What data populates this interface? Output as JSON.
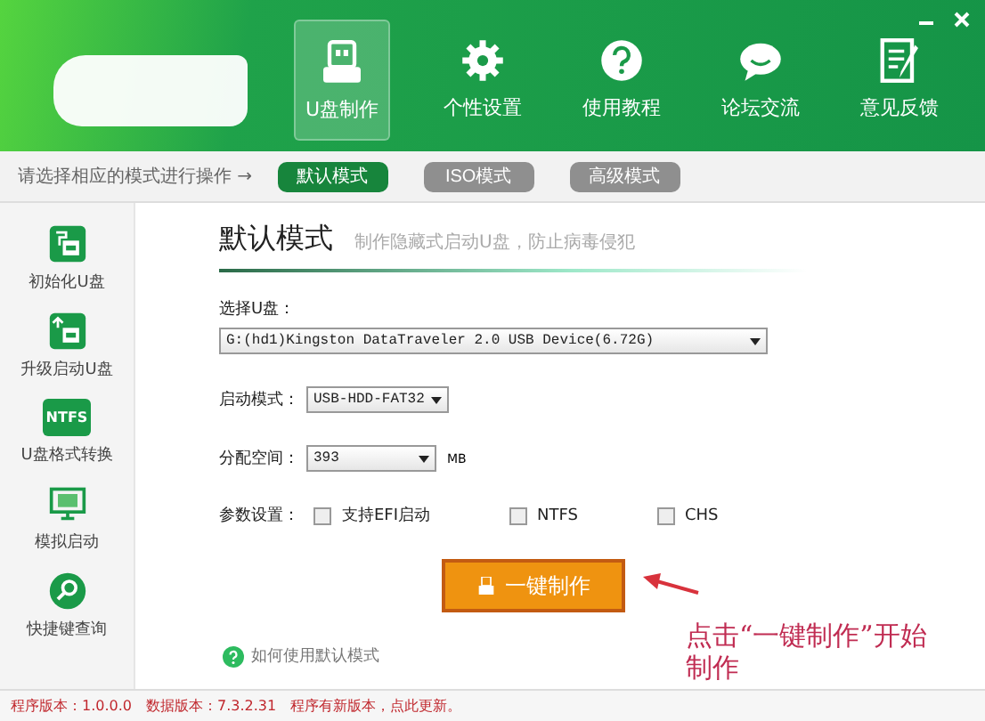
{
  "nav": [
    {
      "label": "U盘制作",
      "selected": true
    },
    {
      "label": "个性设置",
      "selected": false
    },
    {
      "label": "使用教程",
      "selected": false
    },
    {
      "label": "论坛交流",
      "selected": false
    },
    {
      "label": "意见反馈",
      "selected": false
    }
  ],
  "mode_bar": {
    "prompt": "请选择相应的模式进行操作 →",
    "modes": [
      {
        "label": "默认模式",
        "selected": true
      },
      {
        "label": "ISO模式",
        "selected": false
      },
      {
        "label": "高级模式",
        "selected": false
      }
    ]
  },
  "sidebar": [
    {
      "label": "初始化U盘"
    },
    {
      "label": "升级启动U盘"
    },
    {
      "label": "U盘格式转换",
      "badge": "NTFS"
    },
    {
      "label": "模拟启动"
    },
    {
      "label": "快捷键查询"
    }
  ],
  "panel": {
    "title": "默认模式",
    "subtitle": "制作隐藏式启动U盘，防止病毒侵犯",
    "drive_label": "选择U盘：",
    "drive": "G:(hd1)Kingston DataTraveler 2.0 USB Device(6.72G)",
    "boot_label": "启动模式：",
    "boot": "USB-HDD-FAT32",
    "space_label": "分配空间：",
    "space": "393",
    "space_unit": "MB",
    "options_label": "参数设置：",
    "options": [
      {
        "label": "支持EFI启动",
        "checked": false
      },
      {
        "label": "NTFS",
        "checked": false
      },
      {
        "label": "CHS",
        "checked": false
      }
    ],
    "make_button": "一键制作",
    "help_link": "如何使用默认模式",
    "annotation": "点击“一键制作”开始制作"
  },
  "status_bar": [
    "程序版本：1.0.0.0",
    "数据版本：7.3.2.31",
    "程序有新版本，点此更新。"
  ]
}
